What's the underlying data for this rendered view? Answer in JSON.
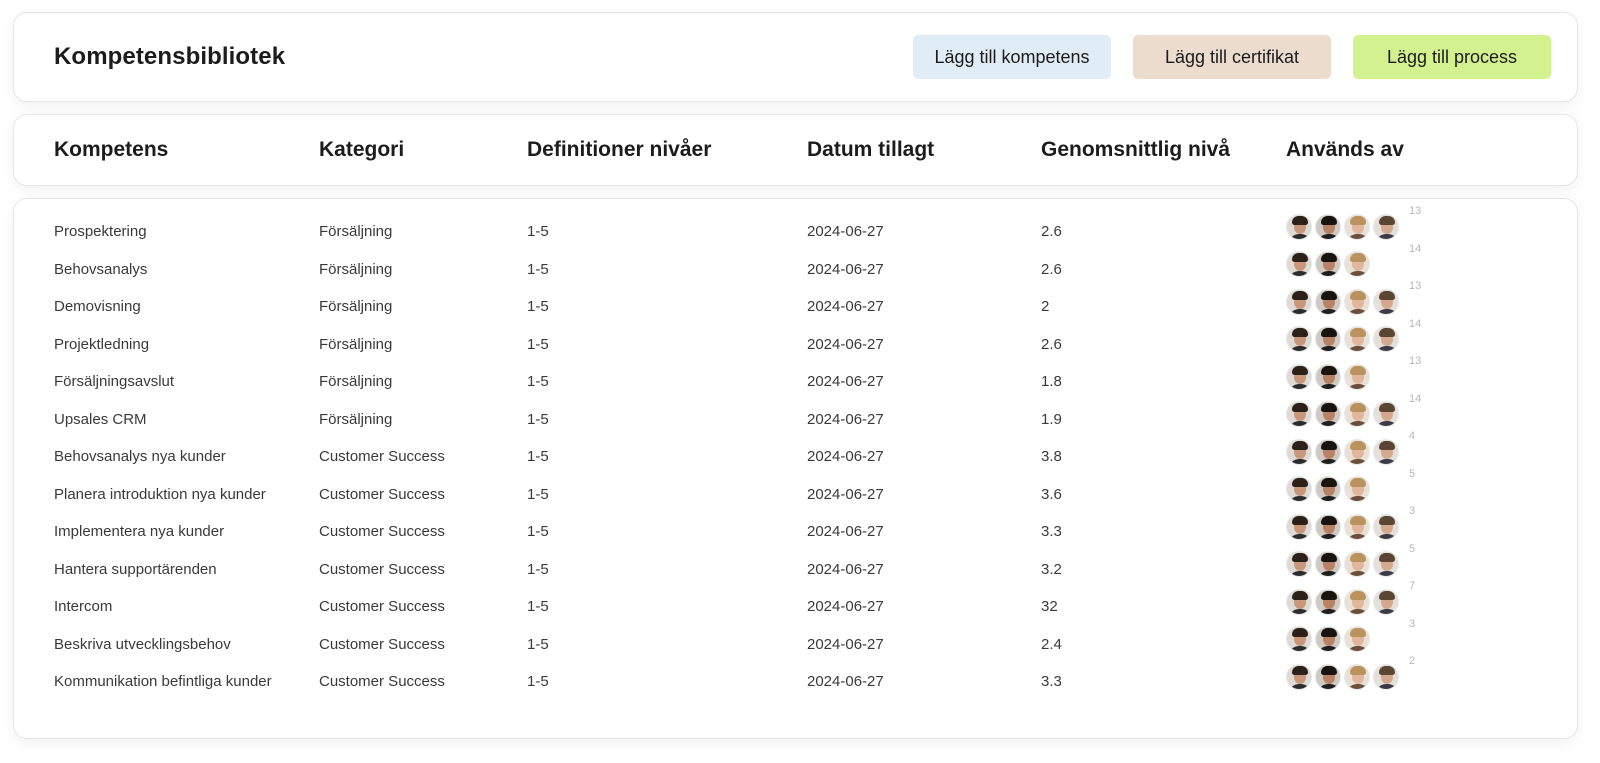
{
  "header": {
    "title": "Kompetensbibliotek",
    "buttons": {
      "add_competence": "Lägg till kompetens",
      "add_certificate": "Lägg till certifikat",
      "add_process": "Lägg till process"
    }
  },
  "table": {
    "columns": [
      "Kompetens",
      "Kategori",
      "Definitioner nivåer",
      "Datum tillagt",
      "Genomsnittlig nivå",
      "Används av"
    ],
    "rows": [
      {
        "name": "Prospektering",
        "category": "Försäljning",
        "levels": "1-5",
        "date": "2024-06-27",
        "avg": "2.6",
        "avatars": 4,
        "count": "13"
      },
      {
        "name": "Behovsanalys",
        "category": "Försäljning",
        "levels": "1-5",
        "date": "2024-06-27",
        "avg": "2.6",
        "avatars": 3,
        "count": "14"
      },
      {
        "name": "Demovisning",
        "category": "Försäljning",
        "levels": "1-5",
        "date": "2024-06-27",
        "avg": "2",
        "avatars": 4,
        "count": "13"
      },
      {
        "name": "Projektledning",
        "category": "Försäljning",
        "levels": "1-5",
        "date": "2024-06-27",
        "avg": "2.6",
        "avatars": 4,
        "count": "14"
      },
      {
        "name": "Försäljningsavslut",
        "category": "Försäljning",
        "levels": "1-5",
        "date": "2024-06-27",
        "avg": "1.8",
        "avatars": 3,
        "count": "13"
      },
      {
        "name": "Upsales CRM",
        "category": "Försäljning",
        "levels": "1-5",
        "date": "2024-06-27",
        "avg": "1.9",
        "avatars": 4,
        "count": "14"
      },
      {
        "name": "Behovsanalys nya kunder",
        "category": "Customer Success",
        "levels": "1-5",
        "date": "2024-06-27",
        "avg": "3.8",
        "avatars": 4,
        "count": "4"
      },
      {
        "name": "Planera introduktion nya kunder",
        "category": "Customer Success",
        "levels": "1-5",
        "date": "2024-06-27",
        "avg": "3.6",
        "avatars": 3,
        "count": "5"
      },
      {
        "name": "Implementera nya kunder",
        "category": "Customer Success",
        "levels": "1-5",
        "date": "2024-06-27",
        "avg": "3.3",
        "avatars": 4,
        "count": "3"
      },
      {
        "name": "Hantera supportärenden",
        "category": "Customer Success",
        "levels": "1-5",
        "date": "2024-06-27",
        "avg": "3.2",
        "avatars": 4,
        "count": "5"
      },
      {
        "name": "Intercom",
        "category": "Customer Success",
        "levels": "1-5",
        "date": "2024-06-27",
        "avg": "32",
        "avatars": 4,
        "count": "7"
      },
      {
        "name": "Beskriva utvecklingsbehov",
        "category": "Customer Success",
        "levels": "1-5",
        "date": "2024-06-27",
        "avg": "2.4",
        "avatars": 3,
        "count": "3"
      },
      {
        "name": "Kommunikation befintliga kunder",
        "category": "Customer Success",
        "levels": "1-5",
        "date": "2024-06-27",
        "avg": "3.3",
        "avatars": 4,
        "count": "2"
      }
    ]
  },
  "colors": {
    "btn_competence": "#e0ecf6",
    "btn_certificate": "#ecdccd",
    "btn_process": "#d3f18f"
  },
  "icons": {
    "avatar": "user-avatar-icon"
  }
}
